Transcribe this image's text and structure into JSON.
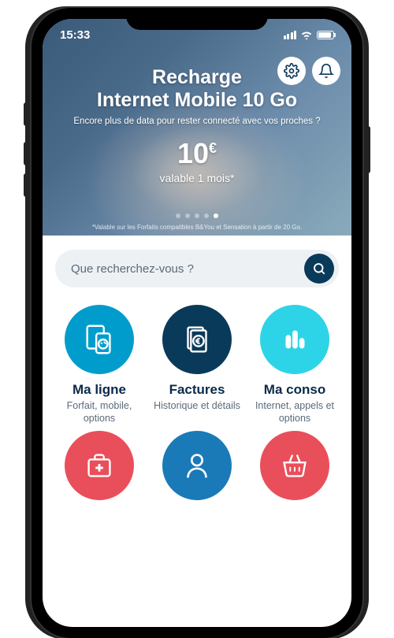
{
  "status_bar": {
    "time": "15:33"
  },
  "hero": {
    "title_line1": "Recharge",
    "title_line2": "Internet Mobile 10 Go",
    "subtitle": "Encore plus de data pour rester connecté avec vos proches ?",
    "price": "10",
    "currency": "€",
    "validity": "valable 1 mois*",
    "footnote": "*Valable sur les Forfaits compatibles B&You et Sensation à partir de 20 Go.",
    "carousel_index_active": 4,
    "carousel_count": 5
  },
  "search": {
    "placeholder": "Que recherchez-vous ?"
  },
  "tiles": [
    {
      "title": "Ma ligne",
      "subtitle": "Forfait, mobile, options",
      "icon": "phone-tablet-icon",
      "color": "c-blue"
    },
    {
      "title": "Factures",
      "subtitle": "Historique et détails",
      "icon": "invoice-euro-icon",
      "color": "c-navy"
    },
    {
      "title": "Ma conso",
      "subtitle": "Internet, appels et options",
      "icon": "bars-chart-icon",
      "color": "c-cyan"
    },
    {
      "title": "",
      "subtitle": "",
      "icon": "first-aid-icon",
      "color": "c-red"
    },
    {
      "title": "",
      "subtitle": "",
      "icon": "person-icon",
      "color": "c-blue2"
    },
    {
      "title": "",
      "subtitle": "",
      "icon": "basket-icon",
      "color": "c-red"
    }
  ],
  "colors": {
    "navy": "#0a3a5a",
    "blue": "#009dcc",
    "cyan": "#2dd4e8",
    "red": "#e94f5a",
    "blue2": "#1a7ab8"
  }
}
